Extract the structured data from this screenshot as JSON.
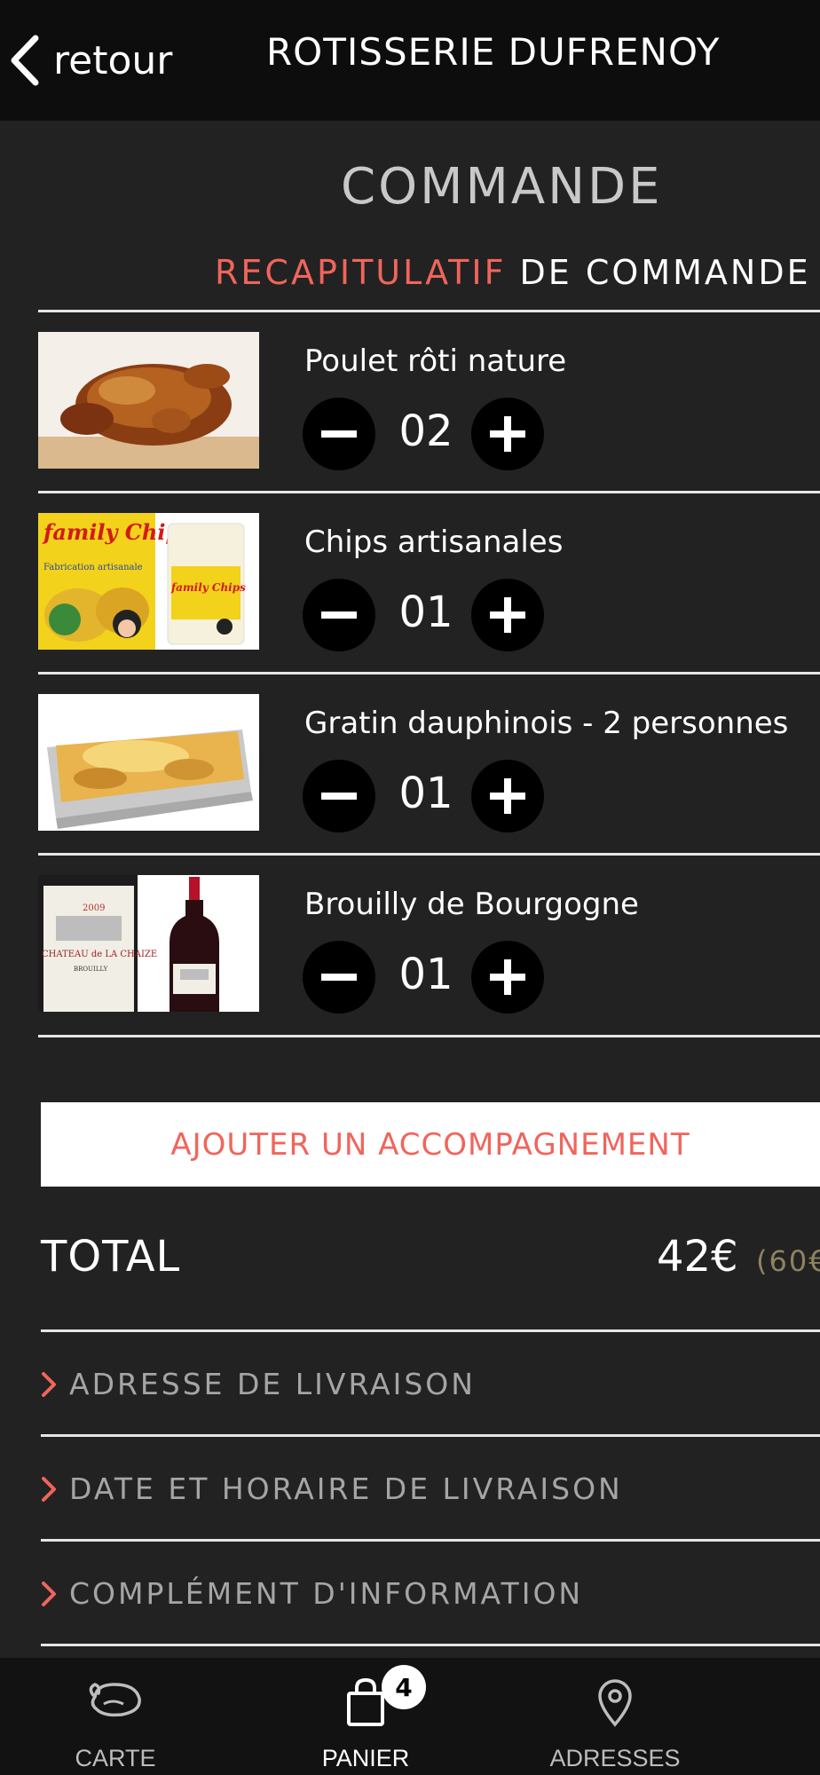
{
  "header": {
    "back_label": "retour",
    "title": "ROTISSERIE DUFRENOY"
  },
  "page": {
    "title": "COMMANDE",
    "section_accent": "RECAPITULATIF",
    "section_rest": " DE COMMANDE"
  },
  "items": [
    {
      "name": "Poulet rôti nature",
      "qty": "02"
    },
    {
      "name": "Chips artisanales",
      "qty": "01"
    },
    {
      "name": "Gratin dauphinois - 2 personnes",
      "qty": "01"
    },
    {
      "name": "Brouilly de Bourgogne",
      "qty": "01"
    }
  ],
  "product_image_text": {
    "chips_brand": "family Chips",
    "chips_line1": "Fabrication artisanale",
    "wine_year": "2009",
    "wine_label": "CHATEAU de LA CHAIZE",
    "wine_sub": "BROUILLY"
  },
  "add_button": "AJOUTER UN ACCOMPAGNEMENT",
  "total": {
    "label": "TOTAL",
    "value": "42€",
    "original": "(60€"
  },
  "accordions": [
    "ADRESSE DE LIVRAISON",
    "DATE ET HORAIRE DE LIVRAISON",
    "COMPLÉMENT D'INFORMATION"
  ],
  "tabbar": {
    "carte": "CARTE",
    "panier": "PANIER",
    "adresses": "ADRESSES",
    "cart_count": "4"
  },
  "colors": {
    "accent": "#f0655c",
    "background": "#222222",
    "topbar": "#0d0d0d",
    "muted_gold": "#8e8360"
  },
  "icons": [
    "chevron-left-icon",
    "minus-icon",
    "plus-icon",
    "chevron-right-icon",
    "chicken-icon",
    "shopping-bag-icon",
    "map-pin-icon"
  ]
}
